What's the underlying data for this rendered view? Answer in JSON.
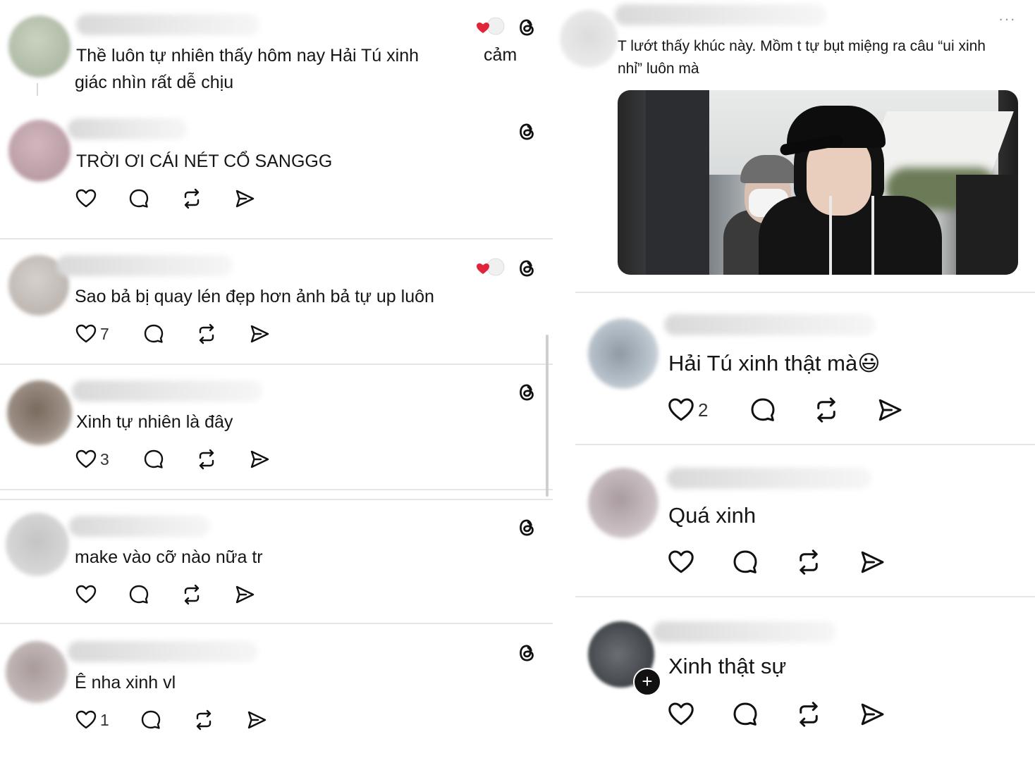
{
  "left_panel": {
    "posts": [
      {
        "text_line1": "Thề luôn tự nhiên thấy hôm nay Hải Tú xinh",
        "text_line2": "giác nhìn rất dễ chịu",
        "side_word": "cảm",
        "likes": ""
      },
      {
        "text_line1": "TRỜI ƠI CÁI NÉT CỔ SANGGG",
        "likes": ""
      },
      {
        "text_line1": "Sao bả bị quay lén đẹp hơn ảnh bả tự up luôn",
        "likes": "7"
      },
      {
        "text_line1": "Xinh tự nhiên là đây",
        "likes": "3"
      },
      {
        "text_line1": "make vào cỡ nào nữa tr",
        "likes": ""
      },
      {
        "text_line1": "Ê nha xinh vl",
        "likes": "1"
      }
    ]
  },
  "right_panel": {
    "top_post": {
      "text": "T lướt thấy khúc này. Mồm t tự bụt miệng ra câu “ui xinh nhỉ” luôn mà",
      "more": "···"
    },
    "replies": [
      {
        "text": "Hải Tú xinh thật mà😃",
        "likes": "2"
      },
      {
        "text": "Quá xinh",
        "likes": ""
      },
      {
        "text": "Xinh thật sự",
        "likes": ""
      }
    ]
  },
  "colors": {
    "heart_red": "#e0243a",
    "divider": "#e6e6e6",
    "text": "#161616"
  },
  "icons": [
    "heart-icon",
    "comment-icon",
    "repost-icon",
    "share-icon",
    "threads-logo-icon",
    "more-icon"
  ]
}
